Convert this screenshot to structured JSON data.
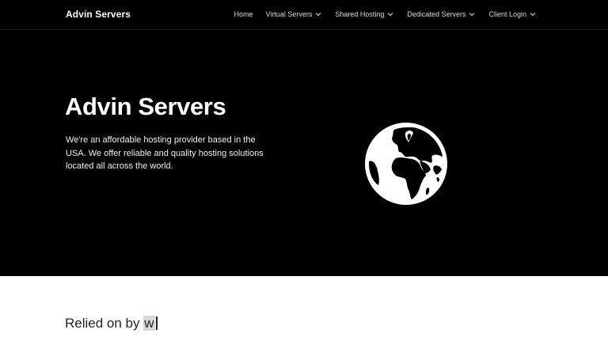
{
  "header": {
    "brand": "Advin Servers",
    "nav": [
      {
        "label": "Home",
        "has_dropdown": false
      },
      {
        "label": "Virtual Servers",
        "has_dropdown": true
      },
      {
        "label": "Shared Hosting",
        "has_dropdown": true
      },
      {
        "label": "Dedicated Servers",
        "has_dropdown": true
      },
      {
        "label": "Client Login",
        "has_dropdown": true
      }
    ]
  },
  "hero": {
    "title": "Advin Servers",
    "description": "We're an affordable hosting provider based in the USA. We offer reliable and quality hosting solutions located all across the world.",
    "icon": "globe-icon"
  },
  "relied": {
    "prefix": "Relied on by ",
    "typed": "w"
  },
  "colors": {
    "background": "#000000",
    "text": "#ffffff",
    "section_bg": "#ffffff",
    "section_text": "#222222"
  }
}
